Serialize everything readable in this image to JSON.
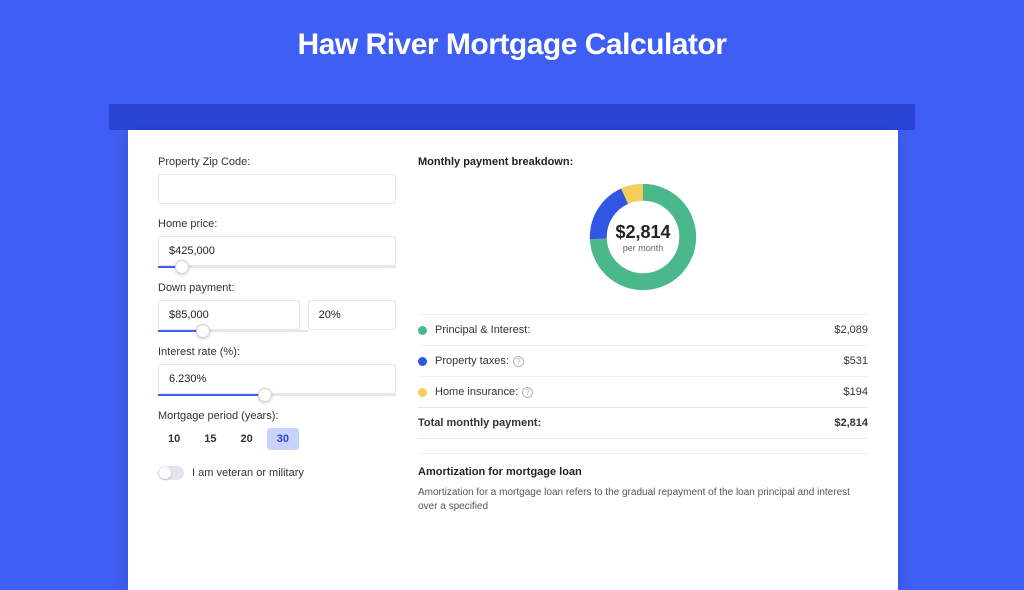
{
  "page_title": "Haw River Mortgage Calculator",
  "form": {
    "zip_label": "Property Zip Code:",
    "zip_value": "",
    "home_price_label": "Home price:",
    "home_price_value": "$425,000",
    "home_price_slider_pct": 10,
    "down_payment_label": "Down payment:",
    "down_payment_value": "$85,000",
    "down_payment_pct_value": "20%",
    "down_payment_slider_pct": 30,
    "interest_label": "Interest rate (%):",
    "interest_value": "6.230%",
    "interest_slider_pct": 45,
    "period_label": "Mortgage period (years):",
    "periods": [
      {
        "label": "10",
        "active": false
      },
      {
        "label": "15",
        "active": false
      },
      {
        "label": "20",
        "active": false
      },
      {
        "label": "30",
        "active": true
      }
    ],
    "veteran_label": "I am veteran or military",
    "veteran_on": false
  },
  "breakdown": {
    "title": "Monthly payment breakdown:",
    "center_amount": "$2,814",
    "center_sub": "per month",
    "rows": [
      {
        "name": "Principal & Interest:",
        "amount": "$2,089",
        "color": "green",
        "info": false
      },
      {
        "name": "Property taxes:",
        "amount": "$531",
        "color": "blue",
        "info": true
      },
      {
        "name": "Home insurance:",
        "amount": "$194",
        "color": "yellow",
        "info": true
      }
    ],
    "total_label": "Total monthly payment:",
    "total_amount": "$2,814"
  },
  "amortization": {
    "title": "Amortization for mortgage loan",
    "text": "Amortization for a mortgage loan refers to the gradual repayment of the loan principal and interest over a specified"
  },
  "chart_data": {
    "type": "pie",
    "title": "Monthly payment breakdown",
    "series": [
      {
        "name": "Principal & Interest",
        "value": 2089,
        "color": "#4ab88a"
      },
      {
        "name": "Property taxes",
        "value": 531,
        "color": "#3156e4"
      },
      {
        "name": "Home insurance",
        "value": 194,
        "color": "#f3ce5d"
      }
    ],
    "total": 2814
  },
  "colors": {
    "accent": "#3f5ef3",
    "green": "#4ab88a",
    "blue": "#3156e4",
    "yellow": "#f3ce5d"
  }
}
